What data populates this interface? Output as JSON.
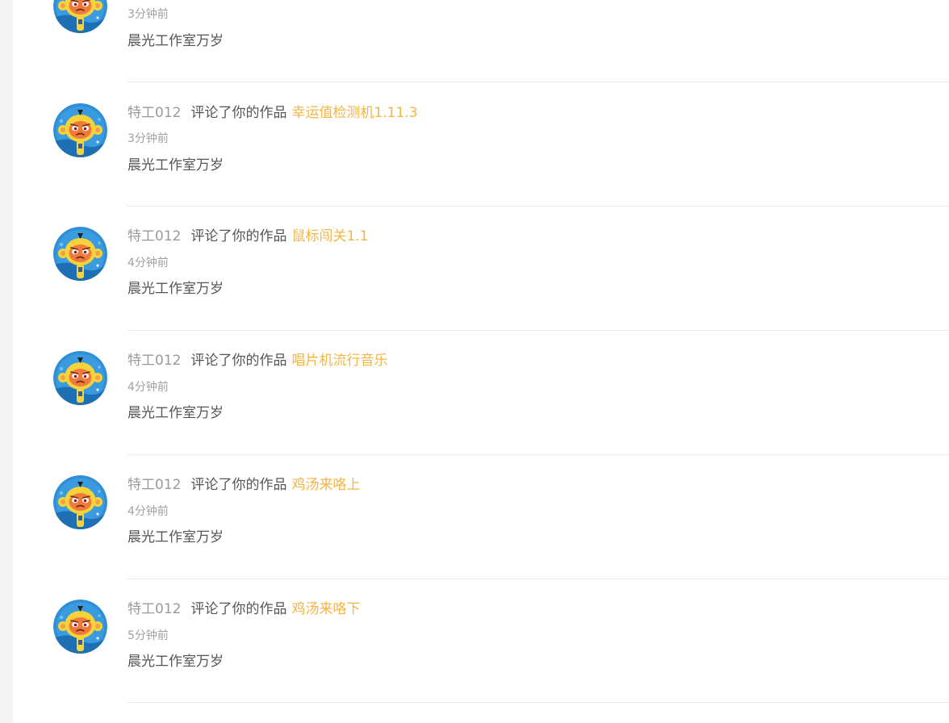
{
  "notifications": [
    {
      "user": "",
      "action": "",
      "work": "",
      "time": "3分钟前",
      "content": "晨光工作室万岁"
    },
    {
      "user": "特工012",
      "action": "评论了你的作品",
      "work": "幸运值检测机1.11.3",
      "time": "3分钟前",
      "content": "晨光工作室万岁"
    },
    {
      "user": "特工012",
      "action": "评论了你的作品",
      "work": "鼠标闯关1.1",
      "time": "4分钟前",
      "content": "晨光工作室万岁"
    },
    {
      "user": "特工012",
      "action": "评论了你的作品",
      "work": "唱片机流行音乐",
      "time": "4分钟前",
      "content": "晨光工作室万岁"
    },
    {
      "user": "特工012",
      "action": "评论了你的作品",
      "work": "鸡汤来咯上",
      "time": "4分钟前",
      "content": "晨光工作室万岁"
    },
    {
      "user": "特工012",
      "action": "评论了你的作品",
      "work": "鸡汤来咯下",
      "time": "5分钟前",
      "content": "晨光工作室万岁"
    }
  ],
  "colors": {
    "work_link": "#f5b444",
    "user_link": "#9a9a9a",
    "body_text": "#555555",
    "time_text": "#a0a0a0",
    "divider": "#ececec"
  },
  "icons": {
    "avatar": "monkey-mascot-avatar"
  }
}
